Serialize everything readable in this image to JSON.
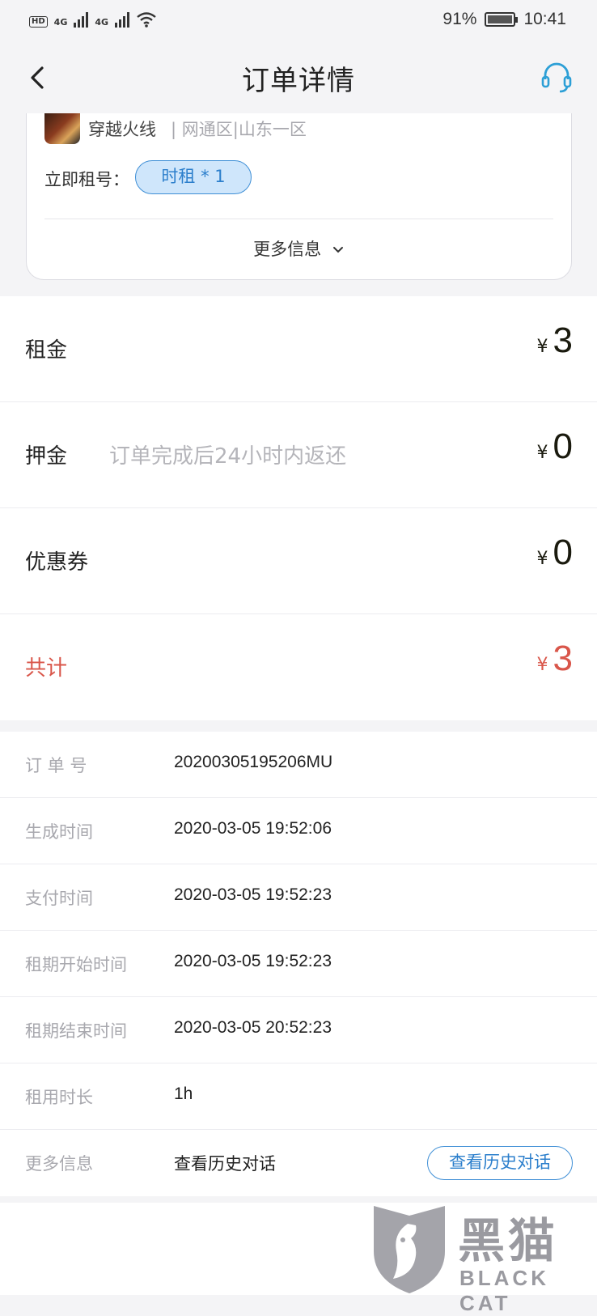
{
  "status_bar": {
    "left_badge": "HD",
    "network_1": "4G",
    "network_2": "4G",
    "battery": "91%",
    "time": "10:41"
  },
  "nav": {
    "title": "订单详情",
    "back_icon": "chevron-left-icon",
    "service_icon": "headset-icon",
    "accent": "#2c9fd6"
  },
  "product": {
    "game_name": "穿越火线",
    "server": "| 网通区|山东一区",
    "rent_label": "立即租号：",
    "rent_tag": "时租 * 1",
    "more_info": "更多信息"
  },
  "fees": {
    "rent": {
      "label": "租金",
      "currency": "¥",
      "amount": "3"
    },
    "deposit": {
      "label": "押金",
      "note": "订单完成后24小时内返还",
      "currency": "¥",
      "amount": "0"
    },
    "coupon": {
      "label": "优惠券",
      "currency": "¥",
      "amount": "0"
    },
    "total": {
      "label": "共计",
      "currency": "¥",
      "amount": "3",
      "color": "#d9564a"
    }
  },
  "details": {
    "order_no": {
      "label": "订 单 号",
      "value": "20200305195206MU"
    },
    "created": {
      "label": "生成时间",
      "value": "2020-03-05 19:52:06"
    },
    "paid": {
      "label": "支付时间",
      "value": "2020-03-05 19:52:23"
    },
    "start": {
      "label": "租期开始时间",
      "value": "2020-03-05 19:52:23"
    },
    "end": {
      "label": "租期结束时间",
      "value": "2020-03-05 20:52:23"
    },
    "duration": {
      "label": "租用时长",
      "value": "1h"
    },
    "more": {
      "label": "更多信息",
      "value": "查看历史对话",
      "button": "查看历史对话"
    }
  },
  "watermark": {
    "cn": "黑猫",
    "en": "BLACK CAT"
  }
}
